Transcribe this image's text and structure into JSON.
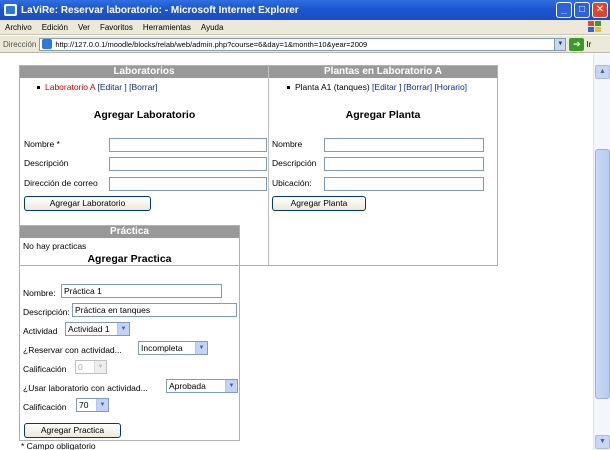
{
  "window": {
    "title": "LaViRe: Reservar laboratorio: - Microsoft Internet Explorer",
    "buttons": {
      "minimize": "_",
      "maximize": "□",
      "close": "✕"
    }
  },
  "menu": [
    "Archivo",
    "Edición",
    "Ver",
    "Favoritos",
    "Herramientas",
    "Ayuda"
  ],
  "address": {
    "label": "Dirección",
    "url": "http://127.0.0.1/moodle/blocks/relab/web/admin.php?course=6&day=1&month=10&year=2009",
    "go_label": "Ir"
  },
  "laboratorios": {
    "header": "Laboratorios",
    "items": [
      {
        "name": "Laboratorio A",
        "edit": "[Editar ]",
        "delete": "[Borrar]"
      }
    ],
    "form_title": "Agregar Laboratorio",
    "fields": {
      "nombre": "Nombre *",
      "descripcion": "Descripción",
      "correo": "Dirección de correo"
    },
    "button": "Agregar Laboratorio"
  },
  "plantas": {
    "header": "Plantas en Laboratorio A",
    "items": [
      {
        "name": "Planta A1 (tanques)",
        "edit": "[Editar ]",
        "delete": "[Borrar]",
        "schedule": "[Horario]"
      }
    ],
    "form_title": "Agregar Planta",
    "fields": {
      "nombre": "Nombre",
      "descripcion": "Descripción",
      "ubicacion": "Ubicación:"
    },
    "button": "Agregar Planta"
  },
  "practica": {
    "header": "Práctica",
    "empty_text": "No hay practicas",
    "form_title": "Agregar Practica",
    "nombre_label": "Nombre:",
    "nombre_value": "Práctica 1",
    "descripcion_label": "Descripción:",
    "descripcion_value": "Práctica en tanques",
    "actividad_label": "Actividad",
    "actividad_value": "Actividad 1",
    "reservar_label": "¿Reservar con actividad...",
    "reservar_value": "Incompleta",
    "calificacion_label": "Calificación",
    "calificacion1_value": "0",
    "usar_label": "¿Usar laboratorio con actividad...",
    "usar_value": "Aprobada",
    "calificacion2_value": "70",
    "button": "Agregar Practica"
  },
  "footer_note": "* Campo obligatorio",
  "colors": {
    "titlebar": "#1d55d1",
    "header_bg": "#999999",
    "lab_link": "#cc0000",
    "link": "#0a2a8c"
  }
}
